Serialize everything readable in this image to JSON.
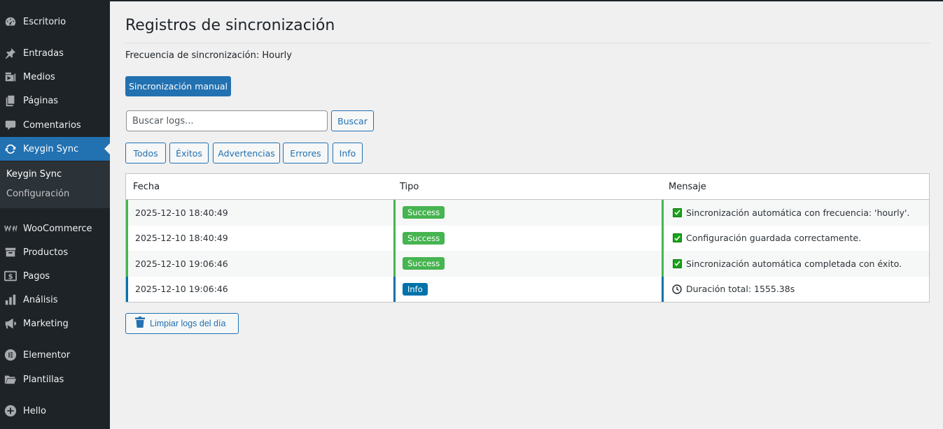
{
  "sidebar": {
    "items": [
      {
        "label": "Escritorio",
        "icon": "dashboard-icon"
      },
      {
        "label": "Entradas",
        "icon": "pushpin-icon"
      },
      {
        "label": "Medios",
        "icon": "media-icon"
      },
      {
        "label": "Páginas",
        "icon": "pages-icon"
      },
      {
        "label": "Comentarios",
        "icon": "comment-icon"
      },
      {
        "label": "Keygin Sync",
        "icon": "sync-icon",
        "active": true
      },
      {
        "label": "WooCommerce",
        "icon": "woocommerce-icon"
      },
      {
        "label": "Productos",
        "icon": "archive-icon"
      },
      {
        "label": "Pagos",
        "icon": "dollar-icon"
      },
      {
        "label": "Análisis",
        "icon": "bar-chart-icon"
      },
      {
        "label": "Marketing",
        "icon": "megaphone-icon"
      },
      {
        "label": "Elementor",
        "icon": "elementor-icon"
      },
      {
        "label": "Plantillas",
        "icon": "folder-icon"
      },
      {
        "label": "Hello",
        "icon": "plus-circle-icon"
      }
    ],
    "submenu": [
      {
        "label": "Keygin Sync",
        "current": true
      },
      {
        "label": "Configuración",
        "current": false
      }
    ]
  },
  "page": {
    "title": "Registros de sincronización",
    "frequency_text": "Frecuencia de sincronización: Hourly",
    "manual_sync_label": "Sincronización manual"
  },
  "search": {
    "placeholder": "Buscar logs...",
    "value": "",
    "button_label": "Buscar"
  },
  "filters": [
    "Todos",
    "Éxitos",
    "Advertencias",
    "Errores",
    "Info"
  ],
  "table": {
    "headers": [
      "Fecha",
      "Tipo",
      "Mensaje"
    ],
    "rows": [
      {
        "date": "2025-12-10 18:40:49",
        "type": "Success",
        "message": "Sincronización automática con frecuencia: 'hourly'.",
        "icon": "check-icon"
      },
      {
        "date": "2025-12-10 18:40:49",
        "type": "Success",
        "message": "Configuración guardada correctamente.",
        "icon": "check-icon"
      },
      {
        "date": "2025-12-10 19:06:46",
        "type": "Success",
        "message": "Sincronización automática completada con éxito.",
        "icon": "check-icon"
      },
      {
        "date": "2025-12-10 19:06:46",
        "type": "Info",
        "message": "Duración total: 1555.38s",
        "icon": "clock-icon"
      }
    ]
  },
  "clear_button_label": "Limpiar logs del día",
  "colors": {
    "sidebar_bg": "#1d2327",
    "accent": "#2271b1",
    "success": "#46b450",
    "info": "#0073aa"
  }
}
